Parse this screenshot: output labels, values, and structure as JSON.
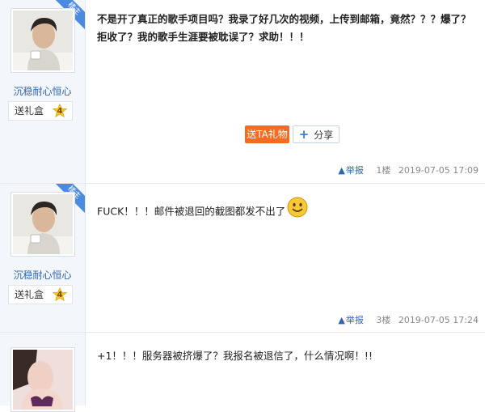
{
  "op_badge": "楼主",
  "posts": [
    {
      "username": "沉稳耐心恒心",
      "gift_label": "送礼盒",
      "level": "4",
      "content": "不是开了真正的歌手项目吗？我录了好几次的视频，上传到邮箱，竟然？？？爆了？拒收了？我的歌手生涯要被耽误了？求助！！！",
      "send_gift_button": "送TA礼物",
      "share_button": "分享",
      "report": "举报",
      "floor": "1楼",
      "time": "2019-07-05 17:09"
    },
    {
      "username": "沉稳耐心恒心",
      "gift_label": "送礼盒",
      "level": "4",
      "content": "FUCK！！！邮件被退回的截图都发不出了",
      "emoji": "smiley-face-icon",
      "report": "举报",
      "floor": "3楼",
      "time": "2019-07-05 17:24"
    },
    {
      "content": "+1！！！服务器被挤爆了？我报名被退信了，什么情况啊！!!"
    }
  ],
  "colors": {
    "accent_blue": "#2d64b3",
    "gift_button": "#f56b22",
    "sidebar_bg": "#f3f6fa",
    "op_ribbon": "#4a8be2"
  }
}
